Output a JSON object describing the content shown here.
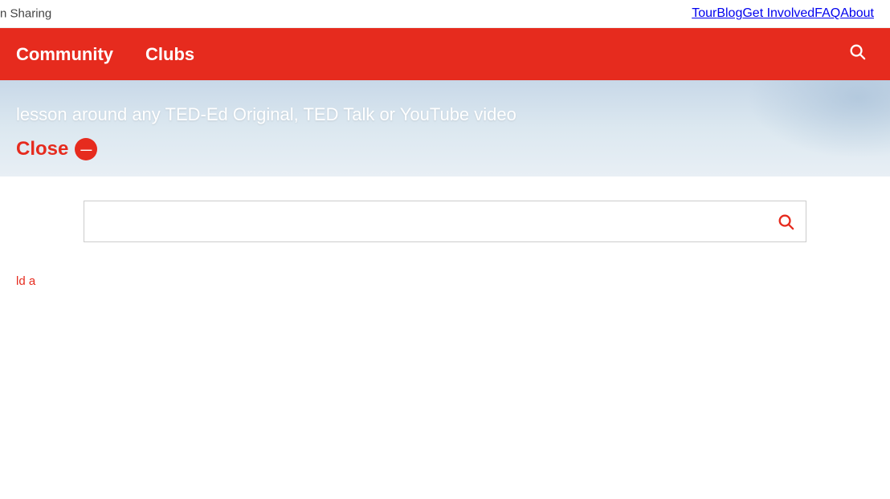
{
  "topbar": {
    "partial_title": "n Sharing",
    "nav_links": [
      {
        "label": "Tour",
        "href": "#"
      },
      {
        "label": "Blog",
        "href": "#"
      },
      {
        "label": "Get Involved",
        "href": "#"
      },
      {
        "label": "FAQ",
        "href": "#"
      },
      {
        "label": "About",
        "href": "#"
      }
    ]
  },
  "rednav": {
    "community_label": "Community",
    "clubs_label": "Clubs",
    "search_icon": "search"
  },
  "hero": {
    "text": "lesson around any TED-Ed Original, TED Talk or YouTube video",
    "close_label": "Close"
  },
  "search": {
    "placeholder": "",
    "submit_icon": "search"
  },
  "content": {
    "partial_text": "ld a"
  }
}
